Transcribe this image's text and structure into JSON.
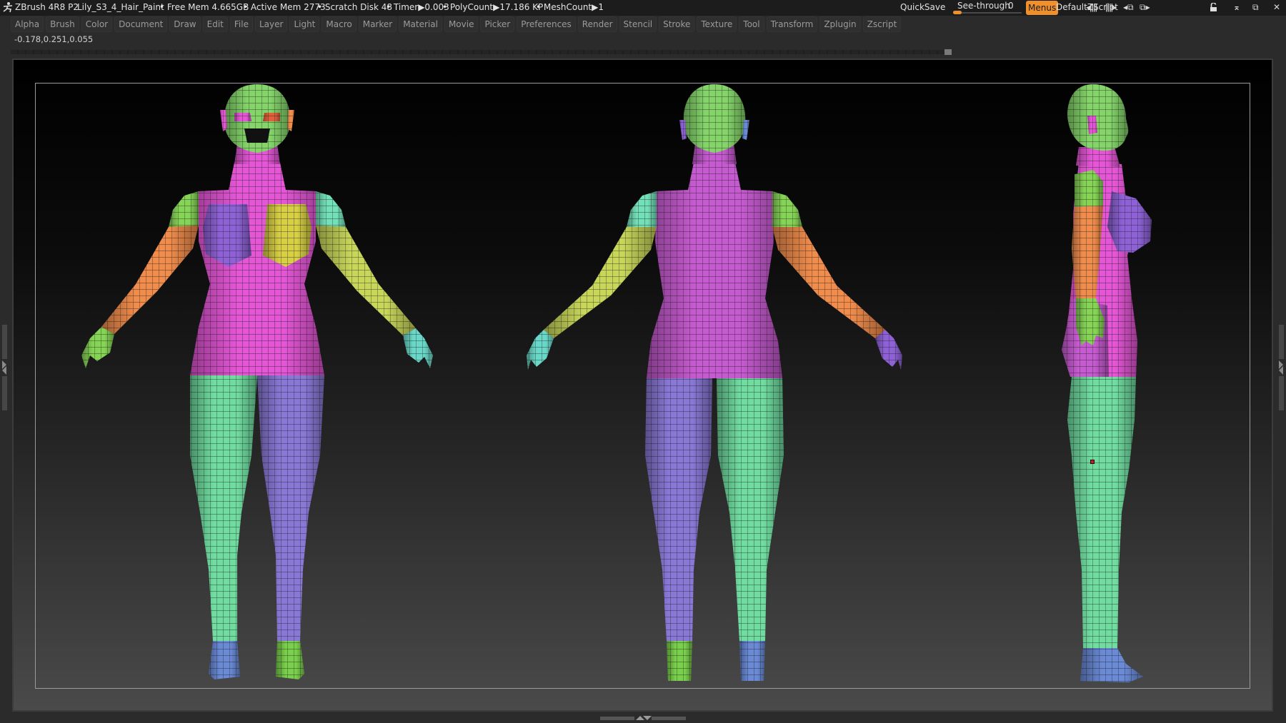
{
  "app": {
    "title": "ZBrush 4R8 P2",
    "document": "Lily_S3_4_Hair_Paint",
    "stats": {
      "free_mem": "• Free Mem 4.665GB",
      "active_mem": "• Active Mem 2773",
      "scratch_disk": "• Scratch Disk 48",
      "timer": "• Timer▶0.003",
      "polycount": "• PolyCount▶17.186 KP",
      "meshcount": "• MeshCount▶1"
    }
  },
  "toolbar_right": {
    "quicksave": "QuickSave",
    "see_through_label": "See-through",
    "see_through_value": "0",
    "see_through_fraction": 0,
    "menus": "Menus",
    "default_zscript": "DefaultZScript",
    "icons": [
      "scroll-left-icon",
      "scroll-right-icon",
      "undock-left-icon",
      "undock-right-icon",
      "lock-icon",
      "minimize-icon",
      "restore-icon",
      "close-icon"
    ],
    "accent_color": "#f0902a"
  },
  "menubar": [
    "Alpha",
    "Brush",
    "Color",
    "Document",
    "Draw",
    "Edit",
    "File",
    "Layer",
    "Light",
    "Macro",
    "Marker",
    "Material",
    "Movie",
    "Picker",
    "Preferences",
    "Render",
    "Stencil",
    "Stroke",
    "Texture",
    "Tool",
    "Transform",
    "Zplugin",
    "Zscript"
  ],
  "coords_readout": "-0.178,0.251,0.055",
  "viewport": {
    "views": [
      "front",
      "back",
      "side"
    ],
    "polygroup_colors": {
      "head": "#84d46a",
      "torso": "#e456d6",
      "torso_back": "#c65ad0",
      "breast_left": "#8e62d6",
      "breast_right": "#d8cf45",
      "shoulder_green": "#86d456",
      "shoulder_teal": "#72e0b8",
      "arm_orange": "#f08c4c",
      "arm_yellow": "#c8d65a",
      "leg_mint": "#70dca0",
      "leg_purple": "#8a78d6",
      "foot_blue": "#6a8ad6",
      "foot_green": "#7ad04c",
      "hand_teal": "#6ad8c8"
    }
  }
}
